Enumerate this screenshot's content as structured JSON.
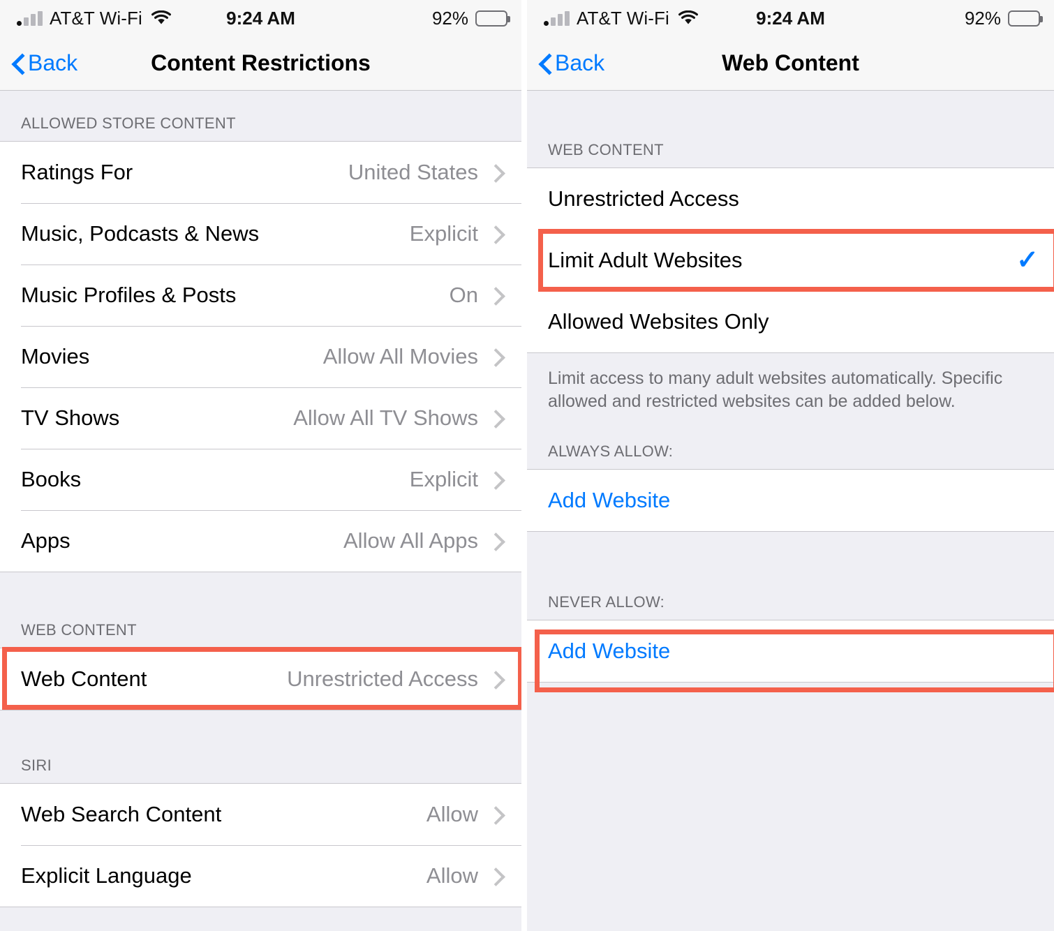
{
  "status_bar": {
    "carrier": "AT&T Wi-Fi",
    "time": "9:24 AM",
    "battery_percent": "92%",
    "signal_icon": "cellular-bars-icon",
    "wifi_icon": "wifi-icon",
    "battery_icon": "battery-icon"
  },
  "colors": {
    "accent_blue": "#007aff",
    "highlight_red": "#f4604b",
    "group_bg": "#efeff4",
    "row_bg": "#ffffff",
    "secondary_text": "#8e8e93",
    "separator": "#c8c7cc"
  },
  "left_screen": {
    "nav": {
      "back_label": "Back",
      "title": "Content Restrictions"
    },
    "sections": [
      {
        "header": "ALLOWED STORE CONTENT",
        "rows": [
          {
            "label": "Ratings For",
            "value": "United States",
            "accessory": "chevron"
          },
          {
            "label": "Music, Podcasts & News",
            "value": "Explicit",
            "accessory": "chevron"
          },
          {
            "label": "Music Profiles & Posts",
            "value": "On",
            "accessory": "chevron"
          },
          {
            "label": "Movies",
            "value": "Allow All Movies",
            "accessory": "chevron"
          },
          {
            "label": "TV Shows",
            "value": "Allow All TV Shows",
            "accessory": "chevron"
          },
          {
            "label": "Books",
            "value": "Explicit",
            "accessory": "chevron"
          },
          {
            "label": "Apps",
            "value": "Allow All Apps",
            "accessory": "chevron"
          }
        ]
      },
      {
        "header": "WEB CONTENT",
        "rows": [
          {
            "label": "Web Content",
            "value": "Unrestricted Access",
            "accessory": "chevron",
            "highlighted": true
          }
        ]
      },
      {
        "header": "SIRI",
        "rows": [
          {
            "label": "Web Search Content",
            "value": "Allow",
            "accessory": "chevron"
          },
          {
            "label": "Explicit Language",
            "value": "Allow",
            "accessory": "chevron"
          }
        ]
      }
    ]
  },
  "right_screen": {
    "nav": {
      "back_label": "Back",
      "title": "Web Content"
    },
    "section_header": "WEB CONTENT",
    "options": [
      {
        "label": "Unrestricted Access",
        "selected": false
      },
      {
        "label": "Limit Adult Websites",
        "selected": true,
        "highlighted": true
      },
      {
        "label": "Allowed Websites Only",
        "selected": false
      }
    ],
    "footer_note": "Limit access to many adult websites automatically. Specific allowed and restricted websites can be added below.",
    "always_allow": {
      "header": "ALWAYS ALLOW:",
      "add_label": "Add Website"
    },
    "never_allow": {
      "header": "NEVER ALLOW:",
      "add_label": "Add Website",
      "highlighted": true
    }
  }
}
